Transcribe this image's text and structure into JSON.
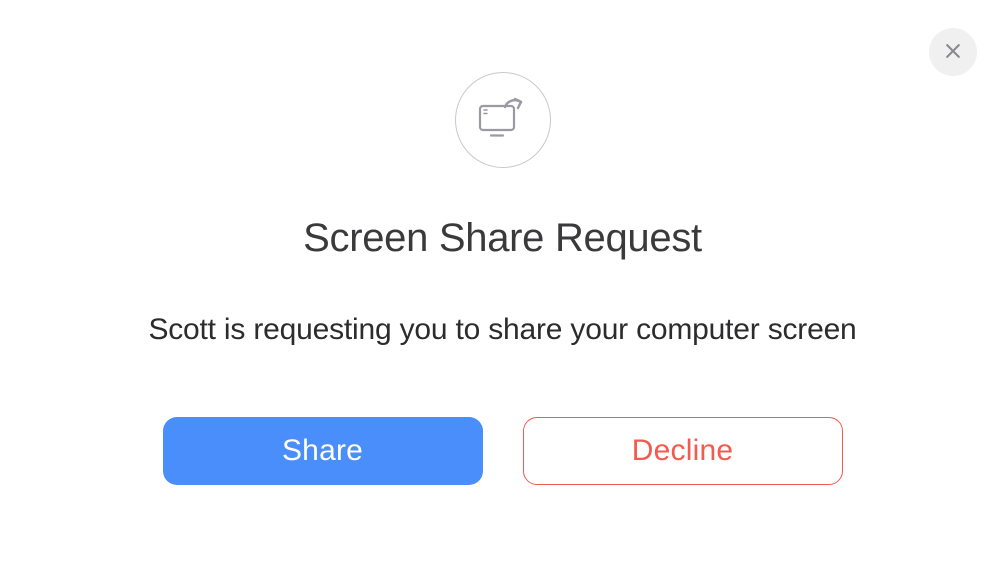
{
  "dialog": {
    "title": "Screen Share Request",
    "message": "Scott is requesting you to share your computer screen",
    "buttons": {
      "primary": "Share",
      "secondary": "Decline"
    }
  }
}
